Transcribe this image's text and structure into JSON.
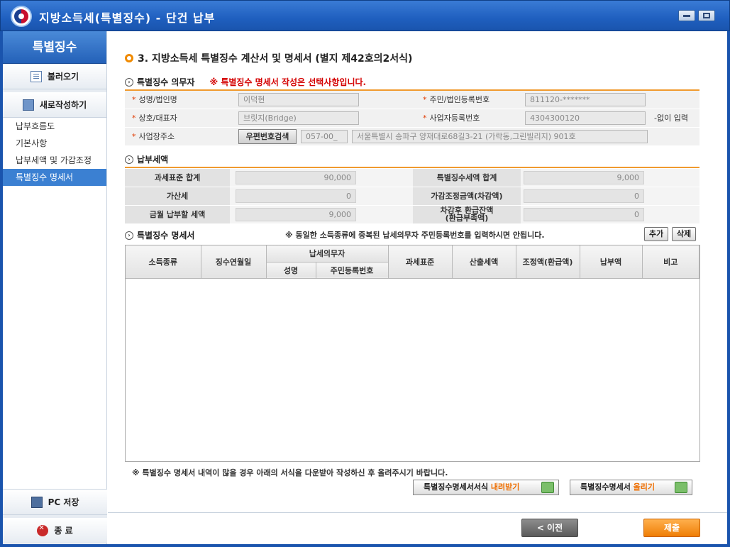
{
  "window": {
    "title": "지방소득세(특별징수) - 단건 납부"
  },
  "sidebar": {
    "header": "특별징수",
    "load_label": "불러오기",
    "new_label": "새로작성하기",
    "menu": [
      "납부흐름도",
      "기본사항",
      "납부세액 및 가감조정",
      "특별징수 명세서"
    ],
    "save_label": "PC 저장",
    "exit_label": "종 료"
  },
  "page": {
    "heading": "3. 지방소득세 특별징수 계산서 및 명세서 (별지 제42호의2서식)"
  },
  "taxpayer": {
    "section_title": "특별징수 의무자",
    "warning": "※ 특별징수 명세서 작성은 선택사항입니다.",
    "name_label": "성명/법인명",
    "name_value": "이덕현",
    "reg_label": "주민/법인등록번호",
    "reg_value": "811120-*******",
    "trade_label": "상호/대표자",
    "trade_value": "브릿지(Bridge)",
    "biz_label": "사업자등록번호",
    "biz_value": "4304300120",
    "biz_note": "-없이 입력",
    "addr_label": "사업장주소",
    "zip_button": "우편번호검색",
    "zip_value": "057-00_",
    "addr_value": "서울특별시 송파구 양재대로68길3-21 (가락동,그린빌리지) 901호"
  },
  "payment": {
    "section_title": "납부세액",
    "base_label": "과세표준 합계",
    "base_value": "90,000",
    "tax_label": "특별징수세액 합계",
    "tax_value": "9,000",
    "penalty_label": "가산세",
    "penalty_value": "0",
    "adjust_label": "가감조정금액(차감액)",
    "adjust_value": "0",
    "month_label": "금월 납부할 세액",
    "month_value": "9,000",
    "refund_label_1": "차감후 환급잔액",
    "refund_label_2": "(환급부족액)",
    "refund_value": "0"
  },
  "detail": {
    "section_title": "특별징수 명세서",
    "notice": "※ 동일한 소득종류에 중복된 납세의무자 주민등록번호를 입력하시면 안됩니다.",
    "add_label": "추가",
    "delete_label": "삭제",
    "columns": {
      "income_type": "소득종류",
      "year_month": "징수연월일",
      "taxpayer_group": "납세의무자",
      "name": "성명",
      "reg_no": "주민등록번호",
      "tax_base": "과세표준",
      "calc_tax": "산출세액",
      "adjust": "조정액(환급액)",
      "pay_amount": "납부액",
      "remark": "비고"
    },
    "bottom_note": "※ 특별징수 명세서 내역이 많을 경우 아래의 서식을 다운받아 작성하신 후 올려주시기 바랍니다.",
    "download_prefix": "특별징수명세서서식 ",
    "download_hl": "내려받기",
    "upload_prefix": "특별징수명세서 ",
    "upload_hl": "올리기"
  },
  "footer": {
    "prev_label": "< 이전",
    "submit_label": "제출"
  }
}
